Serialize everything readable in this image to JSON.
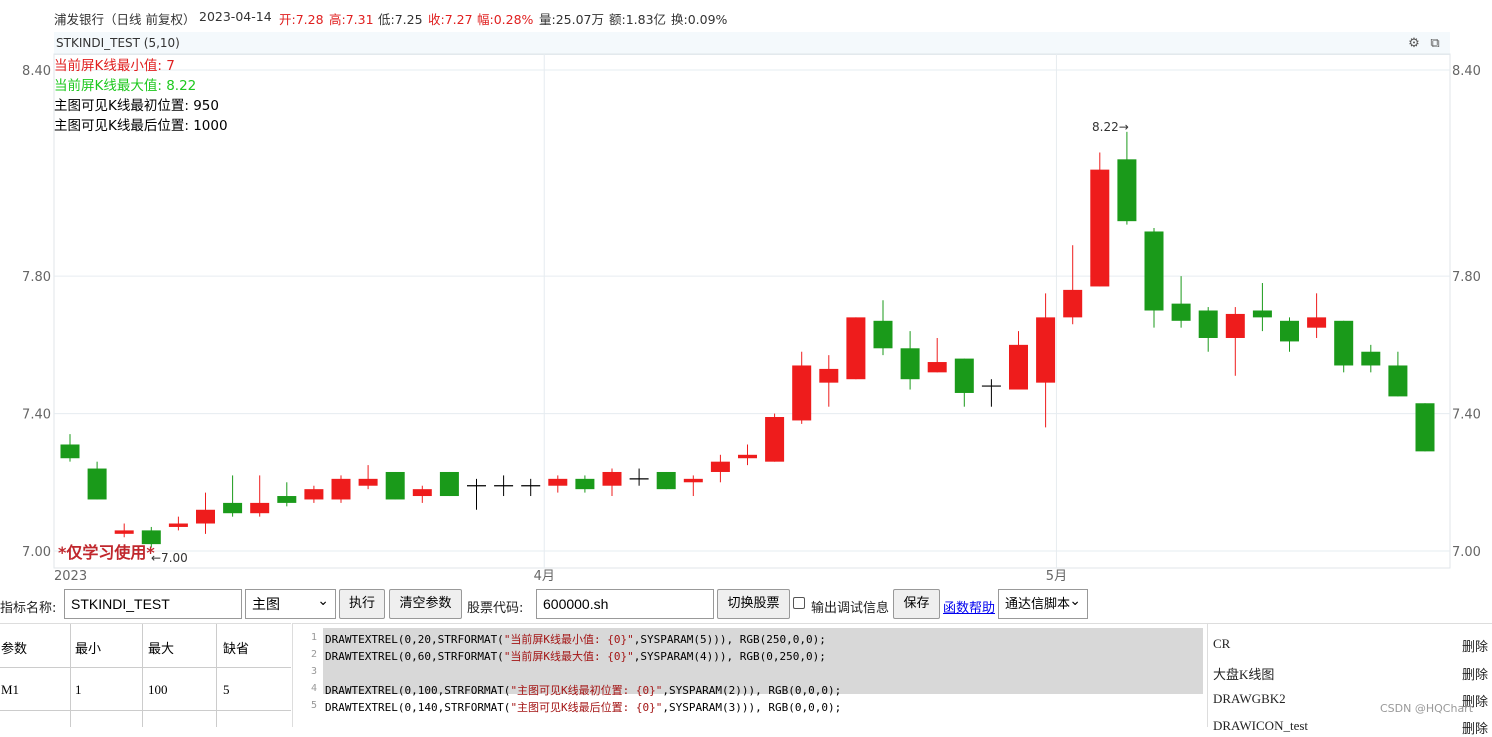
{
  "header": {
    "name": "浦发银行（日线 前复权）",
    "date": "2023-04-14",
    "open": "开:7.28",
    "high": "高:7.31",
    "low": "低:7.25",
    "close": "收:7.27",
    "change": "幅:0.28%",
    "volume": "量:25.07万",
    "amount": "额:1.83亿",
    "turnover": "换:0.09%"
  },
  "indicator_bar": {
    "title": "STKINDI_TEST (5,10)",
    "settings_icon": "sliders-icon",
    "popout_icon": "popout-icon"
  },
  "overlay": {
    "line1": "当前屏K线最小值: 7",
    "line2": "当前屏K线最大值: 8.22",
    "line3": "主图可见K线最初位置: 950",
    "line4": "主图可见K线最后位置: 1000",
    "line1_color": "#e02020",
    "line2_color": "#1ec81e",
    "watermark_text": "*仅学习使用*",
    "min_label": "←7.00",
    "max_label": "8.22→"
  },
  "chart_data": {
    "type": "candlestick",
    "ylim": [
      7.0,
      8.4
    ],
    "yticks": [
      "8.40",
      "7.80",
      "7.40",
      "7.00"
    ],
    "xticks": [
      "2023",
      "4月",
      "5月"
    ],
    "up_color": "#ee1c1c",
    "down_color": "#1a9a1a",
    "candles": [
      {
        "o": 7.31,
        "h": 7.34,
        "l": 7.26,
        "c": 7.27
      },
      {
        "o": 7.24,
        "h": 7.26,
        "l": 7.15,
        "c": 7.15
      },
      {
        "o": 7.05,
        "h": 7.08,
        "l": 7.04,
        "c": 7.06
      },
      {
        "o": 7.06,
        "h": 7.07,
        "l": 7.01,
        "c": 7.02
      },
      {
        "o": 7.07,
        "h": 7.1,
        "l": 7.06,
        "c": 7.08
      },
      {
        "o": 7.08,
        "h": 7.17,
        "l": 7.05,
        "c": 7.12
      },
      {
        "o": 7.14,
        "h": 7.22,
        "l": 7.1,
        "c": 7.11
      },
      {
        "o": 7.11,
        "h": 7.22,
        "l": 7.1,
        "c": 7.14
      },
      {
        "o": 7.16,
        "h": 7.2,
        "l": 7.13,
        "c": 7.14
      },
      {
        "o": 7.15,
        "h": 7.19,
        "l": 7.14,
        "c": 7.18
      },
      {
        "o": 7.15,
        "h": 7.22,
        "l": 7.14,
        "c": 7.21
      },
      {
        "o": 7.19,
        "h": 7.25,
        "l": 7.18,
        "c": 7.21
      },
      {
        "o": 7.23,
        "h": 7.23,
        "l": 7.15,
        "c": 7.15
      },
      {
        "o": 7.16,
        "h": 7.19,
        "l": 7.14,
        "c": 7.18
      },
      {
        "o": 7.23,
        "h": 7.23,
        "l": 7.16,
        "c": 7.16
      },
      {
        "o": 7.19,
        "h": 7.21,
        "l": 7.12,
        "c": 7.19
      },
      {
        "o": 7.19,
        "h": 7.22,
        "l": 7.16,
        "c": 7.19
      },
      {
        "o": 7.19,
        "h": 7.21,
        "l": 7.16,
        "c": 7.19
      },
      {
        "o": 7.19,
        "h": 7.22,
        "l": 7.17,
        "c": 7.21
      },
      {
        "o": 7.21,
        "h": 7.22,
        "l": 7.17,
        "c": 7.18
      },
      {
        "o": 7.19,
        "h": 7.24,
        "l": 7.16,
        "c": 7.23
      },
      {
        "o": 7.21,
        "h": 7.24,
        "l": 7.19,
        "c": 7.21
      },
      {
        "o": 7.23,
        "h": 7.23,
        "l": 7.18,
        "c": 7.18
      },
      {
        "o": 7.2,
        "h": 7.22,
        "l": 7.16,
        "c": 7.21
      },
      {
        "o": 7.23,
        "h": 7.28,
        "l": 7.2,
        "c": 7.26
      },
      {
        "o": 7.27,
        "h": 7.31,
        "l": 7.25,
        "c": 7.28
      },
      {
        "o": 7.26,
        "h": 7.4,
        "l": 7.26,
        "c": 7.39
      },
      {
        "o": 7.38,
        "h": 7.58,
        "l": 7.37,
        "c": 7.54
      },
      {
        "o": 7.49,
        "h": 7.57,
        "l": 7.42,
        "c": 7.53
      },
      {
        "o": 7.5,
        "h": 7.68,
        "l": 7.5,
        "c": 7.68
      },
      {
        "o": 7.67,
        "h": 7.73,
        "l": 7.57,
        "c": 7.59
      },
      {
        "o": 7.59,
        "h": 7.64,
        "l": 7.47,
        "c": 7.5
      },
      {
        "o": 7.52,
        "h": 7.62,
        "l": 7.52,
        "c": 7.55
      },
      {
        "o": 7.56,
        "h": 7.56,
        "l": 7.42,
        "c": 7.46
      },
      {
        "o": 7.48,
        "h": 7.5,
        "l": 7.42,
        "c": 7.48
      },
      {
        "o": 7.47,
        "h": 7.64,
        "l": 7.47,
        "c": 7.6
      },
      {
        "o": 7.49,
        "h": 7.75,
        "l": 7.36,
        "c": 7.68
      },
      {
        "o": 7.68,
        "h": 7.89,
        "l": 7.66,
        "c": 7.76
      },
      {
        "o": 7.77,
        "h": 8.16,
        "l": 7.77,
        "c": 8.11
      },
      {
        "o": 8.14,
        "h": 8.22,
        "l": 7.95,
        "c": 7.96
      },
      {
        "o": 7.93,
        "h": 7.94,
        "l": 7.65,
        "c": 7.7
      },
      {
        "o": 7.72,
        "h": 7.8,
        "l": 7.65,
        "c": 7.67
      },
      {
        "o": 7.7,
        "h": 7.71,
        "l": 7.58,
        "c": 7.62
      },
      {
        "o": 7.62,
        "h": 7.71,
        "l": 7.51,
        "c": 7.69
      },
      {
        "o": 7.7,
        "h": 7.78,
        "l": 7.64,
        "c": 7.68
      },
      {
        "o": 7.67,
        "h": 7.68,
        "l": 7.58,
        "c": 7.61
      },
      {
        "o": 7.65,
        "h": 7.75,
        "l": 7.62,
        "c": 7.68
      },
      {
        "o": 7.67,
        "h": 7.67,
        "l": 7.52,
        "c": 7.54
      },
      {
        "o": 7.58,
        "h": 7.6,
        "l": 7.52,
        "c": 7.54
      },
      {
        "o": 7.54,
        "h": 7.58,
        "l": 7.45,
        "c": 7.45
      },
      {
        "o": 7.43,
        "h": 7.43,
        "l": 7.29,
        "c": 7.29
      }
    ]
  },
  "form": {
    "name_label": "指标名称:",
    "name_value": "STKINDI_TEST",
    "window_select": "主图",
    "execute_button": "执行",
    "clear_button": "清空参数",
    "code_label": "股票代码:",
    "code_value": "600000.sh",
    "switch_button": "切换股票",
    "debug_label": "输出调试信息",
    "save_button": "保存",
    "help_link": "函数帮助",
    "script_select": "通达信脚本"
  },
  "params_table": {
    "headers": [
      "参数",
      "最小",
      "最大",
      "缺省"
    ],
    "rows": [
      [
        "M1",
        "1",
        "100",
        "5"
      ]
    ]
  },
  "code_lines": [
    {
      "num": "1",
      "pre": "DRAWTEXTREL(0,20,STRFORMAT(",
      "str": "\"当前屏K线最小值: {0}\"",
      "post": ",SYSPARAM(5))), RGB(250,0,0);"
    },
    {
      "num": "2",
      "pre": "DRAWTEXTREL(0,60,STRFORMAT(",
      "str": "\"当前屏K线最大值: {0}\"",
      "post": ",SYSPARAM(4))), RGB(0,250,0);"
    },
    {
      "num": "3",
      "pre": "",
      "str": "",
      "post": ""
    },
    {
      "num": "4",
      "pre": "DRAWTEXTREL(0,100,STRFORMAT(",
      "str": "\"主图可见K线最初位置: {0}\"",
      "post": ",SYSPARAM(2))), RGB(0,0,0);"
    },
    {
      "num": "5",
      "pre": "DRAWTEXTREL(0,140,STRFORMAT(",
      "str": "\"主图可见K线最后位置: {0}\"",
      "post": ",SYSPARAM(3))), RGB(0,0,0);"
    }
  ],
  "script_list": {
    "items": [
      "CR",
      "大盘K线图",
      "DRAWGBK2",
      "DRAWICON_test"
    ],
    "delete_label": "删除"
  },
  "footer": {
    "watermark": "CSDN @HQChart"
  }
}
